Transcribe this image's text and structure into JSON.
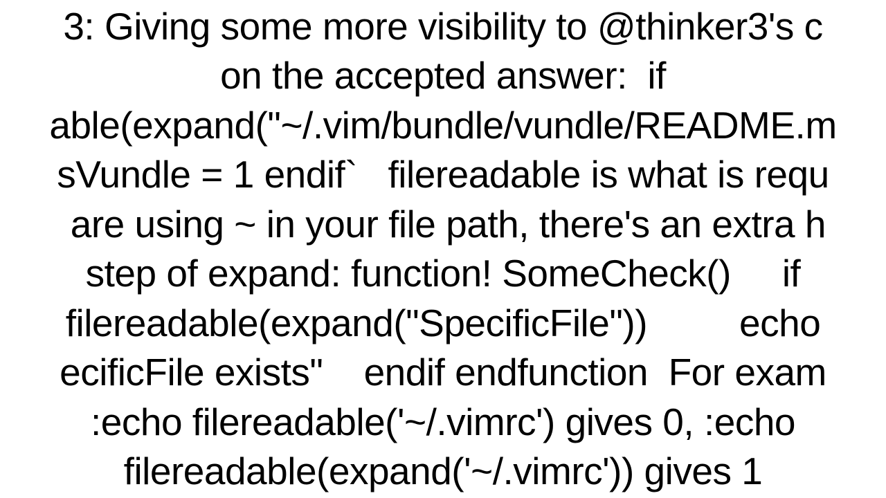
{
  "content": {
    "text": "3: Giving some more visibility to @thinker3's c\non the accepted answer:  if\nable(expand(\"~/.vim/bundle/vundle/README.m\nsVundle = 1 endif`   filereadable is what is requ\n are using ~ in your file path, there's an extra h\nstep of expand: function! SomeCheck()     if\nfilereadable(expand(\"SpecificFile\"))         echo\necificFile exists\"    endif endfunction  For exam\n:echo filereadable('~/.vimrc') gives 0, :echo\nfilereadable(expand('~/.vimrc')) gives 1"
  }
}
